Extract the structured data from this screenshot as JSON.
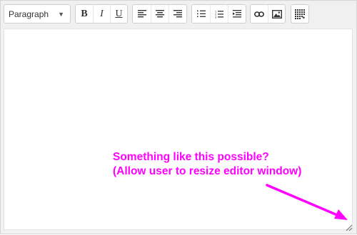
{
  "toolbar": {
    "format_select": {
      "value": "Paragraph",
      "options": [
        "Paragraph"
      ]
    },
    "buttons": [
      {
        "name": "bold-button",
        "icon": "bold-icon",
        "glyph": "B"
      },
      {
        "name": "italic-button",
        "icon": "italic-icon",
        "glyph": "I"
      },
      {
        "name": "underline-button",
        "icon": "underline-icon",
        "glyph": "U"
      },
      {
        "name": "align-left-button",
        "icon": "align-left-icon"
      },
      {
        "name": "align-center-button",
        "icon": "align-center-icon"
      },
      {
        "name": "align-right-button",
        "icon": "align-right-icon"
      },
      {
        "name": "bullet-list-button",
        "icon": "bullet-list-icon"
      },
      {
        "name": "numbered-list-button",
        "icon": "numbered-list-icon"
      },
      {
        "name": "indent-button",
        "icon": "indent-icon"
      },
      {
        "name": "link-button",
        "icon": "link-icon"
      },
      {
        "name": "image-button",
        "icon": "image-icon"
      },
      {
        "name": "table-button",
        "icon": "table-grid-icon"
      }
    ]
  },
  "editor": {
    "content": ""
  },
  "annotation": {
    "line1": "Something like this possible?",
    "line2": "(Allow user to resize editor window)",
    "color": "#ff00ff"
  },
  "resize_handle": {
    "icon": "resize-grip-icon"
  }
}
